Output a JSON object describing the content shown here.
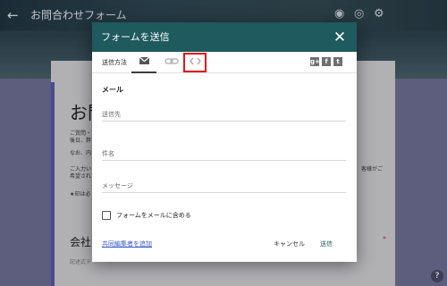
{
  "app": {
    "title": "お問合わせフォーム",
    "back_icon": "arrow-left-icon",
    "palette_icon": "palette-icon",
    "preview_icon": "eye-icon",
    "settings_icon": "gear-icon"
  },
  "background": {
    "heading": "お問",
    "lines": [
      "ご質問・ご",
      "後日、弊",
      "なお、内",
      "ご入力い",
      "希望され",
      "★印は必"
    ],
    "right_text": "客様がご",
    "company_label": "会社名",
    "company_hint": "記述式テ",
    "required_mark": "*",
    "help_label": "?"
  },
  "dialog": {
    "title": "フォームを送信",
    "close_icon": "close-icon",
    "send_method_label": "送信方法",
    "methods": [
      {
        "name": "email",
        "icon": "mail-icon",
        "selected": true
      },
      {
        "name": "link",
        "icon": "link-icon",
        "selected": false
      },
      {
        "name": "embed",
        "icon": "code-icon",
        "selected": false
      }
    ],
    "share": {
      "gplus": "g+",
      "facebook": "f",
      "twitter": "t"
    },
    "section_title": "メール",
    "fields": {
      "to": {
        "label": "送信先",
        "value": ""
      },
      "subject": {
        "label": "件名",
        "value": ""
      },
      "message": {
        "label": "メッセージ",
        "value": ""
      }
    },
    "include_form_label": "フォームをメールに含める",
    "include_form_checked": false,
    "add_collaborators": "共同編集者を追加",
    "cancel": "キャンセル",
    "send": "送信"
  },
  "colors": {
    "dialog_header": "#1e5a5e",
    "highlight": "#e01515",
    "link": "#3757c8"
  }
}
